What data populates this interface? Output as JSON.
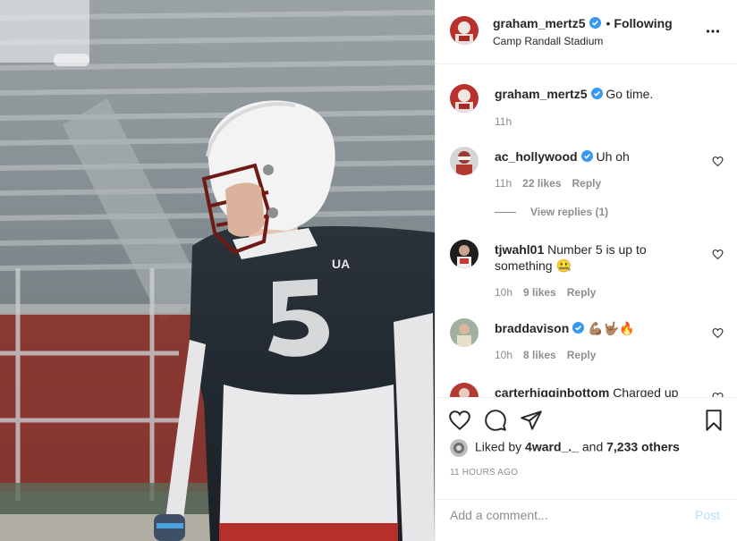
{
  "post": {
    "username": "graham_mertz5",
    "follow_label": "Following",
    "location": "Camp Randall Stadium",
    "jersey_number": "5"
  },
  "comments": [
    {
      "username": "graham_mertz5",
      "text": "Go time.",
      "time": "11h",
      "verified": true
    },
    {
      "username": "ac_hollywood",
      "text": "Uh oh",
      "time": "11h",
      "likes": "22 likes",
      "reply": "Reply",
      "verified": true
    },
    {
      "username": "tjwahl01",
      "text": "Number 5 is up to something 🤐",
      "time": "10h",
      "likes": "9 likes",
      "reply": "Reply",
      "verified": false
    },
    {
      "username": "braddavison",
      "text": "💪🏽🤟🏽🔥",
      "time": "10h",
      "likes": "8 likes",
      "reply": "Reply",
      "verified": true
    },
    {
      "username": "carterhigginbottom",
      "text": "Charged up",
      "verified": false
    }
  ],
  "view_replies": "View replies (1)",
  "engagement": {
    "liked_by_prefix": "Liked by",
    "liked_by_user": "4ward_._",
    "and_label": "and",
    "others_count": "7,233 others",
    "timestamp": "11 HOURS AGO"
  },
  "add_comment": {
    "placeholder": "Add a comment...",
    "post_label": "Post"
  },
  "colors": {
    "verified": "#3897f0",
    "post_button": "#b2dffc",
    "muted_text": "#8e8e8e"
  }
}
